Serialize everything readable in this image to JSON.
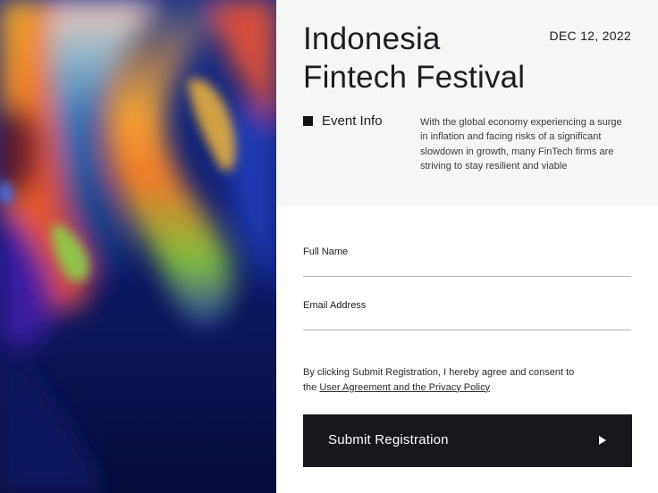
{
  "event": {
    "title_line1": "Indonesia",
    "title_line2": "Fintech Festival",
    "date": "DEC 12, 2022",
    "info_label": "Event Info",
    "description": "With the global economy experiencing a surge in inflation and facing risks of a significant slowdown in growth, many FinTech firms are striving to stay resilient and viable"
  },
  "form": {
    "full_name_label": "Full Name",
    "full_name_value": "",
    "email_label": "Email Address",
    "email_value": "",
    "consent_text": "By clicking Submit Registration, I hereby agree and consent to the ",
    "consent_link": "User Agreement and the Privacy Policy",
    "submit_label": "Submit Registration"
  },
  "icons": {
    "event_info": "square-bullet-icon",
    "submit": "play-arrow-icon"
  },
  "colors": {
    "header_bg": "#f6f6f6",
    "button_bg": "#17171c",
    "divider": "#b4b4b8"
  }
}
